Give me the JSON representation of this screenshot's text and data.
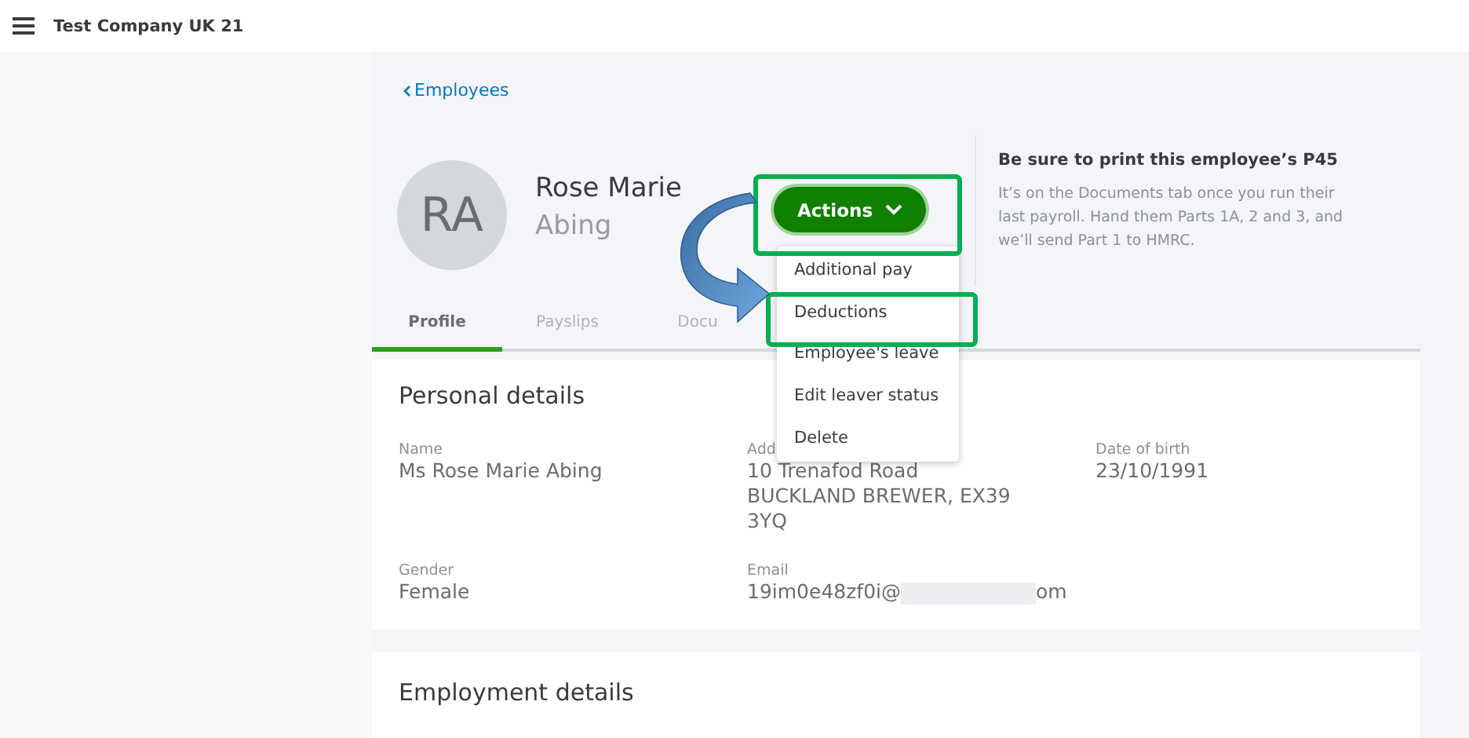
{
  "top_bar": {
    "company": "Test Company UK 21"
  },
  "back_link": "Employees",
  "employee": {
    "initials": "RA",
    "first_line": "Rose Marie",
    "second_line": "Abing"
  },
  "actions_button": {
    "label": "Actions",
    "expanded": true
  },
  "actions_menu": [
    {
      "label": "Additional pay",
      "highlighted": false
    },
    {
      "label": "Deductions",
      "highlighted": true
    },
    {
      "label": "Employee's leave",
      "highlighted": false
    },
    {
      "label": "Edit leaver status",
      "highlighted": false
    },
    {
      "label": "Delete",
      "highlighted": false
    }
  ],
  "notice": {
    "title": "Be sure to print this employee’s P45",
    "body": "It’s on the Documents tab once you run their last payroll. Hand them Parts 1A, 2 and 3, and we’ll send Part 1 to HMRC."
  },
  "tabs": [
    {
      "label": "Profile",
      "selected": true
    },
    {
      "label": "Payslips",
      "selected": false
    },
    {
      "label": "Docu",
      "selected": false
    }
  ],
  "personal_details": {
    "title": "Personal details",
    "fields": [
      {
        "label": "Name",
        "lines": [
          "Ms Rose Marie Abing"
        ]
      },
      {
        "label": "Add",
        "lines": [
          "10 Trenafod Road",
          "BUCKLAND BREWER, EX39",
          "3YQ"
        ]
      },
      {
        "label": "Date of birth",
        "lines": [
          "23/10/1991"
        ]
      },
      {
        "label": "Gender",
        "lines": [
          "Female"
        ]
      },
      {
        "label": "Email",
        "lines": [
          "19im0e48zf0i@"
        ],
        "redacted_tail": "om"
      }
    ]
  },
  "employment_details": {
    "title": "Employment details"
  }
}
